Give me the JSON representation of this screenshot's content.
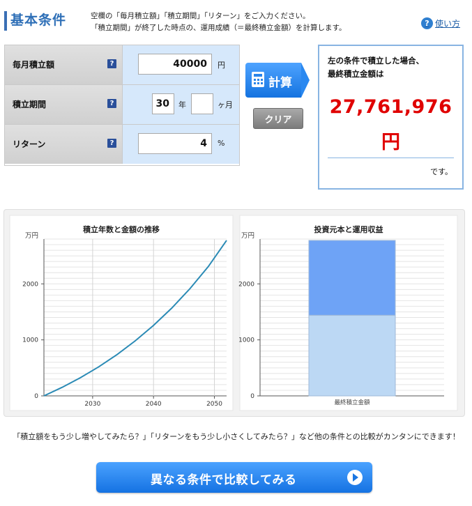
{
  "header": {
    "title": "基本条件",
    "desc_line1": "空欄の「毎月積立額」「積立期間」「リターン」をご入力ください。",
    "desc_line2": "「積立期間」が終了した時点の、運用成績（＝最終積立金額）を計算します。",
    "help_icon_text": "?",
    "help_label": "使い方"
  },
  "form": {
    "monthly": {
      "label": "毎月積立額",
      "value": "40000",
      "unit": "円"
    },
    "period": {
      "label": "積立期間",
      "years_value": "30",
      "years_unit": "年",
      "months_value": "",
      "months_unit": "ヶ月"
    },
    "return": {
      "label": "リターン",
      "value": "4",
      "unit": "%"
    },
    "help_icon_text": "?"
  },
  "buttons": {
    "calc": "計算",
    "clear": "クリア"
  },
  "result": {
    "line1": "左の条件で積立した場合、",
    "line2": "最終積立金額は",
    "amount": "27,761,976",
    "yen": "円",
    "suffix": "です。"
  },
  "colors": {
    "accent": "#2e6fb7",
    "result_red": "#e00000",
    "line": "#2a8ab5",
    "bar_top": "#6ea3f6",
    "bar_bottom": "#bcd8f4"
  },
  "chart_data": [
    {
      "type": "line",
      "title": "積立年数と金額の推移",
      "ylabel": "万円",
      "xlim": [
        2022,
        2052
      ],
      "ylim": [
        0,
        2800
      ],
      "yticks": [
        0,
        1000,
        2000
      ],
      "xticks": [
        2030,
        2040,
        2050
      ],
      "x": [
        2022,
        2025,
        2028,
        2031,
        2034,
        2037,
        2040,
        2043,
        2046,
        2049,
        2052
      ],
      "y": [
        0,
        153,
        325,
        519,
        737,
        983,
        1258,
        1568,
        1917,
        2310,
        2776
      ]
    },
    {
      "type": "bar",
      "title": "投資元本と運用収益",
      "ylabel": "万円",
      "ylim": [
        0,
        2800
      ],
      "yticks": [
        0,
        1000,
        2000
      ],
      "categories": [
        "最終積立金額"
      ],
      "stacked": true,
      "series": [
        {
          "values": [
            1440
          ]
        },
        {
          "values": [
            1336
          ]
        }
      ]
    }
  ],
  "bottom": {
    "text": "「積立額をもう少し増やしてみたら？」「リターンをもう少し小さくしてみたら？」など他の条件との比較がカンタンにできます！",
    "compare_button": "異なる条件で比較してみる"
  }
}
